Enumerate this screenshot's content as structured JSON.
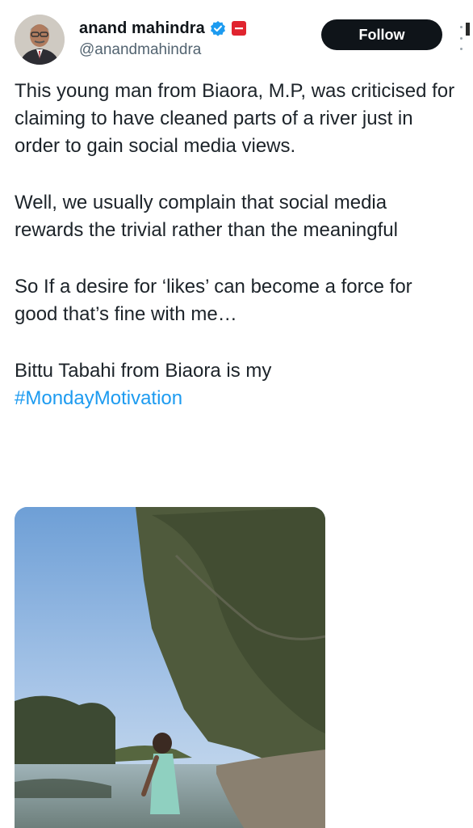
{
  "user": {
    "display_name": "anand mahindra",
    "handle": "@anandmahindra",
    "verified_icon": "verified-badge-icon",
    "affiliate_icon": "affiliate-badge-icon"
  },
  "actions": {
    "follow_label": "Follow",
    "more_icon": "more-vertical-icon"
  },
  "tweet": {
    "para1": "This young man from Biaora, M.P, was criticised for claiming to have cleaned parts of a river just in order to gain social media views.",
    "para2": "Well, we usually complain that social media rewards the trivial rather than the meaningful",
    "para3": "So If a desire for ‘likes’ can become a force for good that’s fine with me…",
    "para4_text": "Bittu Tabahi from Biaora is my",
    "hashtag": "#MondayMotivation"
  },
  "colors": {
    "link": "#1d9bf0",
    "follow_bg": "#0f1419",
    "verified": "#1d9bf0",
    "affiliate": "#e0242f"
  }
}
